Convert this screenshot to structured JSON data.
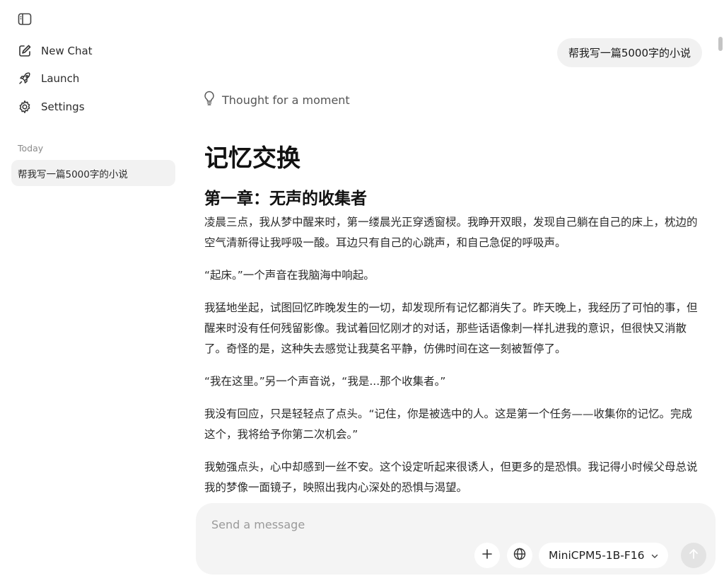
{
  "sidebar": {
    "nav": [
      {
        "label": "New Chat",
        "icon": "pencil-square-icon"
      },
      {
        "label": "Launch",
        "icon": "rocket-icon"
      },
      {
        "label": "Settings",
        "icon": "gear-icon"
      }
    ],
    "section_label": "Today",
    "history": [
      {
        "title": "帮我写一篇5000字的小说"
      }
    ]
  },
  "chat": {
    "user_message": "帮我写一篇5000字的小说",
    "thought_label": "Thought for a moment",
    "story_title": "记忆交换",
    "chapter_title": "第一章：无声的收集者",
    "paragraphs": [
      "凌晨三点，我从梦中醒来时，第一缕晨光正穿透窗棂。我睁开双眼，发现自己躺在自己的床上，枕边的空气清新得让我呼吸一酸。耳边只有自己的心跳声，和自己急促的呼吸声。",
      "“起床。”一个声音在我脑海中响起。",
      "我猛地坐起，试图回忆昨晚发生的一切，却发现所有记忆都消失了。昨天晚上，我经历了可怕的事，但醒来时没有任何残留影像。我试着回忆刚才的对话，那些话语像刺一样扎进我的意识，但很快又消散了。奇怪的是，这种失去感觉让我莫名平静，仿佛时间在这一刻被暂停了。",
      "“我在这里。”另一个声音说，“我是...那个收集者。”",
      "我没有回应，只是轻轻点了点头。“记住，你是被选中的人。这是第一个任务——收集你的记忆。完成这个，我将给予你第二次机会。”",
      "我勉强点头，心中却感到一丝不安。这个设定听起来很诱人，但更多的是恐惧。我记得小时候父母总说我的梦像一面镜子，映照出我内心深处的恐惧与渴望。"
    ]
  },
  "composer": {
    "placeholder": "Send a message",
    "model_name": "MiniCPM5-1B-F16"
  },
  "colors": {
    "accent_bg": "#f4f4f4",
    "bubble_bg": "#f1f1f1",
    "send_disabled": "#e3e3e3"
  }
}
